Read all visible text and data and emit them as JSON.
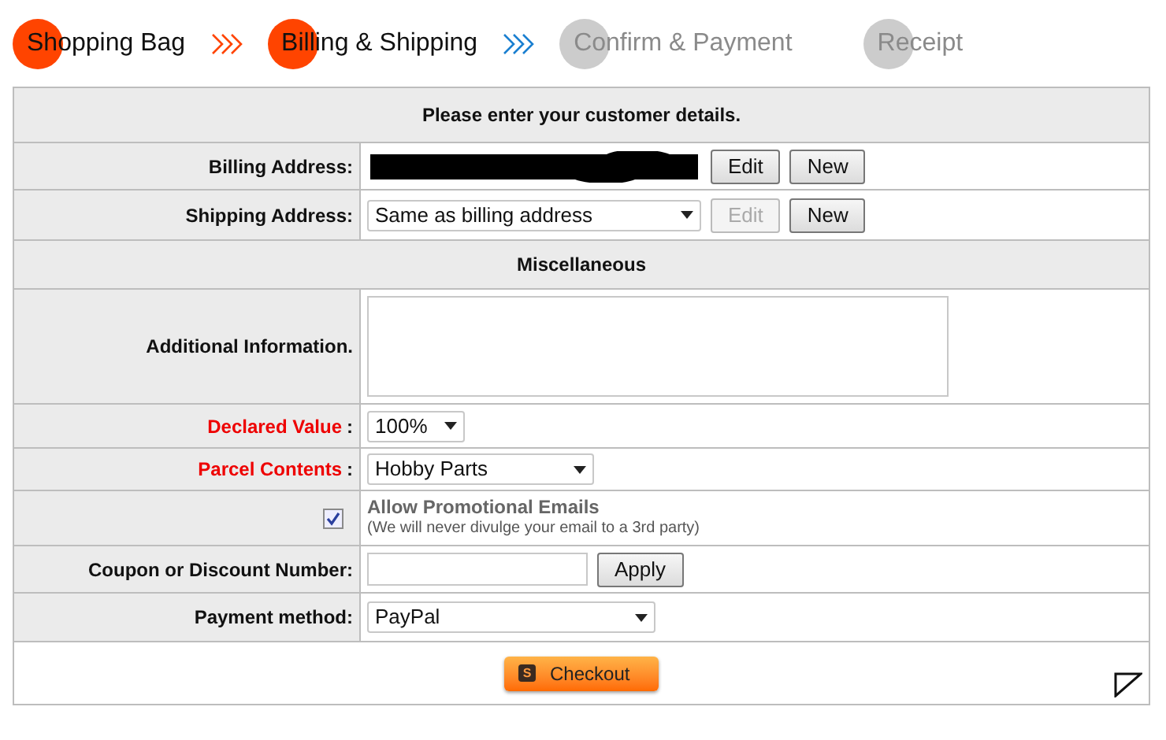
{
  "steps": [
    {
      "label": "Shopping Bag",
      "active": true,
      "color": "#ff4400"
    },
    {
      "label": "Billing & Shipping",
      "active": true,
      "color": "#1a7fd0"
    },
    {
      "label": "Confirm & Payment",
      "active": false
    },
    {
      "label": "Receipt",
      "active": false
    }
  ],
  "header": "Please enter your customer details.",
  "billing": {
    "label": "Billing Address:",
    "redacted": true,
    "buttons": [
      {
        "label": "Edit",
        "disabled": false
      },
      {
        "label": "New",
        "disabled": false
      }
    ]
  },
  "shipping": {
    "label": "Shipping Address:",
    "value": "Same as billing address",
    "buttons": [
      {
        "label": "Edit",
        "disabled": true
      },
      {
        "label": "New",
        "disabled": false
      }
    ]
  },
  "misc_header": "Miscellaneous",
  "additional_info": {
    "label": "Additional Information."
  },
  "declared_value": {
    "label": "Declared Value",
    "colon": ":",
    "value": "100%",
    "required": true
  },
  "parcel_contents": {
    "label": "Parcel Contents",
    "colon": ":",
    "value": "Hobby Parts",
    "required": true
  },
  "promo": {
    "checked": true,
    "label": "Allow Promotional Emails",
    "note": "(We will never divulge your email to a 3rd party)"
  },
  "coupon": {
    "label": "Coupon or Discount Number:",
    "button": "Apply"
  },
  "payment": {
    "label": "Payment method:",
    "value": "PayPal"
  },
  "checkout": {
    "icon_text": "S",
    "label": "Checkout"
  }
}
